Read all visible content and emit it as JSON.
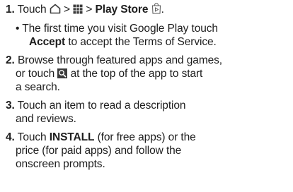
{
  "steps": [
    {
      "number": "1.",
      "parts": {
        "touch": "Touch",
        "sep1": ">",
        "sep2": ">",
        "play_store": "Play Store",
        "period": "."
      },
      "bullet": {
        "dot": "•",
        "line1": "The first time you visit Google Play touch",
        "accept": "Accept",
        "line2_rest": "to accept the Terms of Service."
      }
    },
    {
      "number": "2.",
      "line1": "Browse through featured apps and games,",
      "line2_before": "or touch",
      "line2_after": "at the top of the app to start",
      "line3": "a search."
    },
    {
      "number": "3.",
      "line1": "Touch an item to read a description",
      "line2": "and reviews."
    },
    {
      "number": "4.",
      "line1_before": "Touch",
      "install": "INSTALL",
      "line1_after": "(for free apps) or the",
      "line2": "price (for paid apps) and follow the",
      "line3": "onscreen prompts."
    }
  ],
  "icons": {
    "home": "home-icon",
    "apps": "apps-grid-icon",
    "play_store": "play-store-icon",
    "search": "search-icon"
  },
  "colors": {
    "text": "#1d1d1d",
    "icon": "#3c3c3c"
  }
}
